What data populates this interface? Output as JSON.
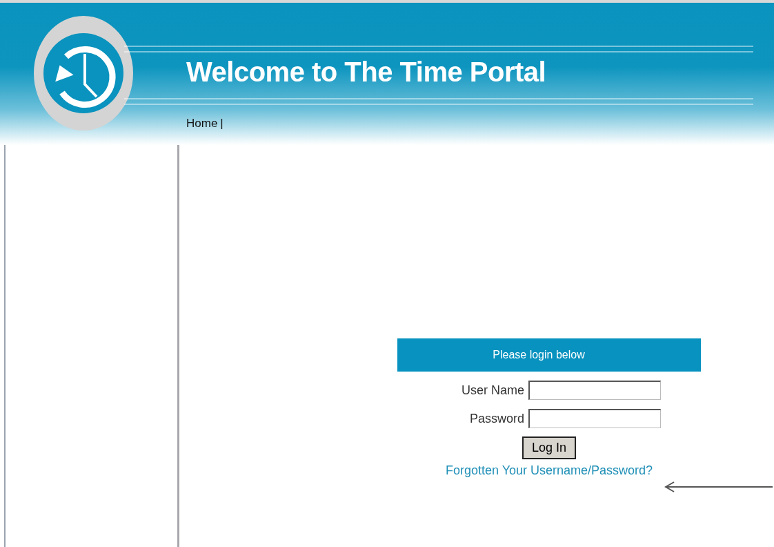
{
  "header": {
    "title": "Welcome to The Time Portal"
  },
  "nav": [
    {
      "label": "Home",
      "separator": "|"
    }
  ],
  "login": {
    "heading": "Please login below",
    "fields": [
      {
        "label": "User Name"
      },
      {
        "label": "Password"
      }
    ],
    "button": "Log In",
    "link": "Forgotten Your Username/Password?"
  }
}
